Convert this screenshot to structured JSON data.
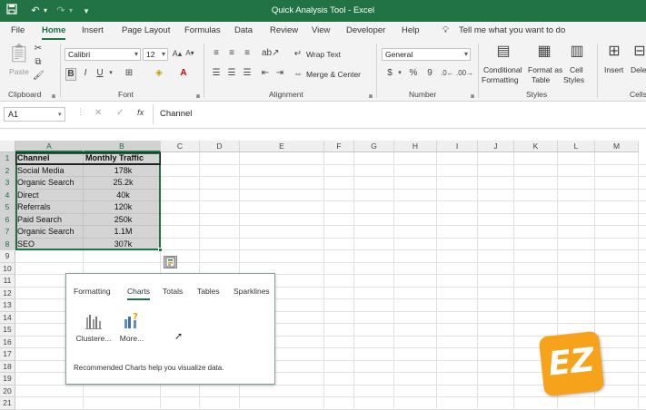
{
  "window": {
    "title": "Quick Analysis Tool  -  Excel"
  },
  "qat": {
    "save_icon": "save-icon",
    "undo_icon": "undo-icon",
    "redo_icon": "redo-icon",
    "customize_icon": "customize-icon"
  },
  "ribbon_tabs": [
    "File",
    "Home",
    "Insert",
    "Page Layout",
    "Formulas",
    "Data",
    "Review",
    "View",
    "Developer",
    "Help"
  ],
  "active_tab": "Home",
  "tell_me": "Tell me what you want to do",
  "clipboard": {
    "paste_label": "Paste",
    "group_label": "Clipboard"
  },
  "font": {
    "name": "Calibri",
    "size": "12",
    "group_label": "Font",
    "bold": "B",
    "italic": "I",
    "underline": "U"
  },
  "alignment": {
    "wrap_text": "Wrap Text",
    "merge_center": "Merge & Center",
    "group_label": "Alignment"
  },
  "number": {
    "format": "General",
    "group_label": "Number",
    "currency": "$",
    "percent": "%",
    "comma": "9"
  },
  "styles": {
    "conditional_formatting": [
      "Conditional",
      "Formatting"
    ],
    "format_as_table": [
      "Format as",
      "Table"
    ],
    "cell_styles": [
      "Cell",
      "Styles"
    ],
    "group_label": "Styles"
  },
  "cells": {
    "insert": "Insert",
    "delete": "Delete",
    "group_label": "Cells"
  },
  "formula_bar": {
    "name_box": "A1",
    "content": "Channel",
    "fx": "fx",
    "cancel": "✕",
    "enter": "✓"
  },
  "columns": [
    "A",
    "B",
    "C",
    "D",
    "E",
    "F",
    "G",
    "H",
    "I",
    "J",
    "K",
    "L",
    "M"
  ],
  "rows": [
    "1",
    "2",
    "3",
    "4",
    "5",
    "6",
    "7",
    "8",
    "9",
    "10",
    "11",
    "12",
    "13",
    "14",
    "15",
    "16",
    "17",
    "18",
    "19",
    "20",
    "21"
  ],
  "table": {
    "headers": [
      "Channel",
      "Monthly Traffic"
    ],
    "rows": [
      [
        "Social Media",
        "178k"
      ],
      [
        "Organic Search",
        "25.2k"
      ],
      [
        "Direct",
        "40k"
      ],
      [
        "Referrals",
        "120k"
      ],
      [
        "Paid Search",
        "250k"
      ],
      [
        "Organic Search",
        "1.1M"
      ],
      [
        "SEO",
        "307k"
      ]
    ]
  },
  "quick_analysis": {
    "tabs": [
      "Formatting",
      "Charts",
      "Totals",
      "Tables",
      "Sparklines"
    ],
    "active_tab": "Charts",
    "options": [
      {
        "label": "Clustere...",
        "icon": "clustered-bar-chart-icon"
      },
      {
        "label": "More...",
        "icon": "more-charts-icon"
      }
    ],
    "description": "Recommended Charts help you visualize data."
  },
  "logo": {
    "text": "EZ"
  }
}
